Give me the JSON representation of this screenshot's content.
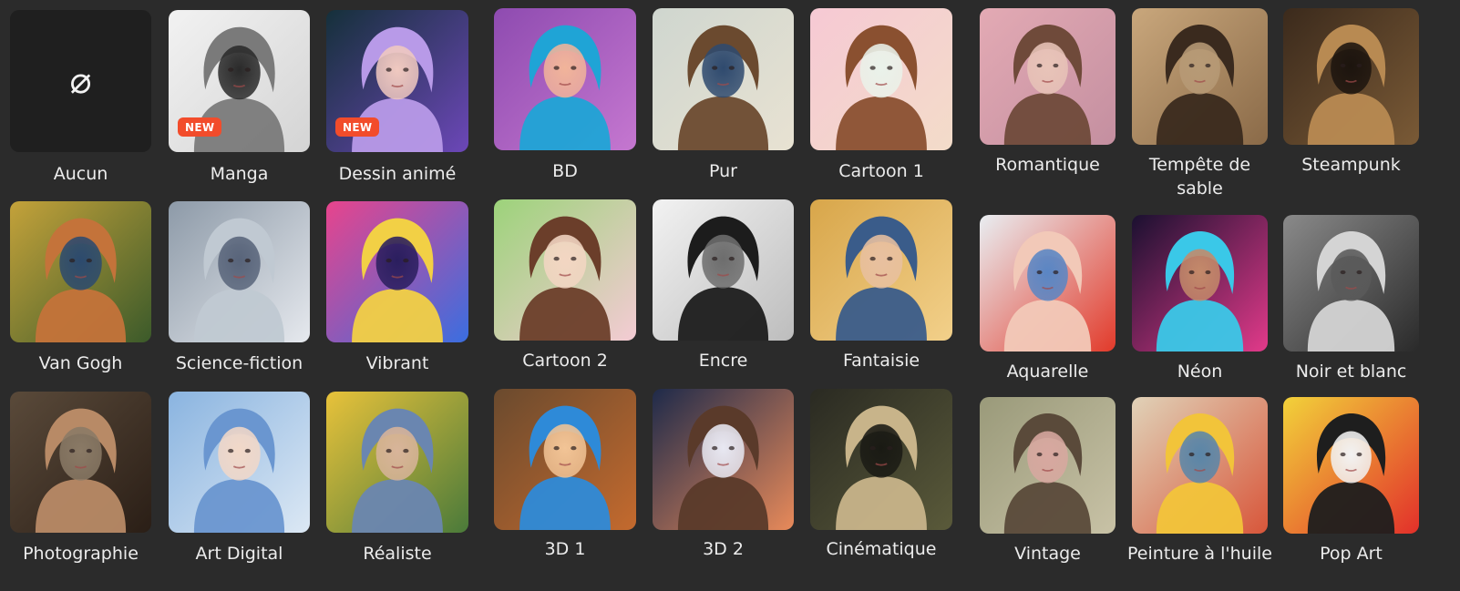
{
  "badge_label": "NEW",
  "none_symbol": "⌀",
  "styles": [
    {
      "label": "Aucun",
      "icon": "none-icon",
      "colors": [
        "#1f1f1f",
        "#1f1f1f",
        "#1f1f1f",
        "#1f1f1f"
      ]
    },
    {
      "label": "Manga",
      "icon": "manga-portrait-thumbnail",
      "colors": [
        "#f2f2f2",
        "#d4d4d4",
        "#7a7a7a",
        "#2a2a2a"
      ]
    },
    {
      "label": "Dessin animé",
      "icon": "cartoon-drawing-thumbnail",
      "colors": [
        "#15303a",
        "#6c47b8",
        "#b89ae8",
        "#f0c9c0"
      ]
    },
    {
      "label": "BD",
      "icon": "comic-thumbnail",
      "colors": [
        "#8e4bb0",
        "#c577d0",
        "#1fa4d6",
        "#f1b49a"
      ]
    },
    {
      "label": "Pur",
      "icon": "pure-photo-thumbnail",
      "colors": [
        "#cfd6cf",
        "#e8e2d2",
        "#6b4a2f",
        "#2f4a6e"
      ]
    },
    {
      "label": "Cartoon 1",
      "icon": "cartoon1-thumbnail",
      "colors": [
        "#f6c9d4",
        "#f3dcc9",
        "#8a5030",
        "#eaf2ea"
      ]
    },
    {
      "label": "Romantique",
      "icon": "romantic-thumbnail",
      "colors": [
        "#e3aab4",
        "#c48fa0",
        "#6f4a3a",
        "#e8c4b8"
      ]
    },
    {
      "label": "Tempête de sable",
      "icon": "sandstorm-thumbnail",
      "colors": [
        "#c9a77c",
        "#8a6a48",
        "#3a2a1e",
        "#b79a76"
      ]
    },
    {
      "label": "Steampunk",
      "icon": "steampunk-thumbnail",
      "colors": [
        "#3b2a1c",
        "#7a5a36",
        "#b88a52",
        "#1c140e"
      ]
    },
    {
      "label": "Van Gogh",
      "icon": "van-gogh-thumbnail",
      "colors": [
        "#c4a23a",
        "#3b5a2a",
        "#c4733a",
        "#2c4a6e"
      ]
    },
    {
      "label": "Science-fiction",
      "icon": "scifi-thumbnail",
      "colors": [
        "#8d9aa8",
        "#e6e9ee",
        "#c0c9d2",
        "#58647a"
      ]
    },
    {
      "label": "Vibrant",
      "icon": "vibrant-thumbnail",
      "colors": [
        "#e8448c",
        "#3a6ee0",
        "#f2d045",
        "#2a1e5e"
      ]
    },
    {
      "label": "Cartoon 2",
      "icon": "cartoon2-thumbnail",
      "colors": [
        "#9cd37a",
        "#f4cbd4",
        "#6b3e2a",
        "#f3d6c3"
      ]
    },
    {
      "label": "Encre",
      "icon": "ink-thumbnail",
      "colors": [
        "#f2f2f2",
        "#bdbdbd",
        "#1c1c1c",
        "#6d6d6d"
      ]
    },
    {
      "label": "Fantaisie",
      "icon": "fantasy-thumbnail",
      "colors": [
        "#d8a64a",
        "#f2d08a",
        "#3a5c8a",
        "#e8c0a0"
      ]
    },
    {
      "label": "Aquarelle",
      "icon": "watercolor-thumbnail",
      "colors": [
        "#e9eef2",
        "#e23a2a",
        "#f2c9b8",
        "#5a86c4"
      ]
    },
    {
      "label": "Néon",
      "icon": "neon-thumbnail",
      "colors": [
        "#1a1030",
        "#e23a8a",
        "#3ac8e8",
        "#c48a6a"
      ]
    },
    {
      "label": "Noir et blanc",
      "icon": "black-white-thumbnail",
      "colors": [
        "#8a8a8a",
        "#2a2a2a",
        "#d4d4d4",
        "#5a5a5a"
      ]
    },
    {
      "label": "Photographie",
      "icon": "photography-thumbnail",
      "colors": [
        "#5a4a3a",
        "#2a1e16",
        "#b88a66",
        "#8a7a66"
      ]
    },
    {
      "label": "Art Digital",
      "icon": "digital-art-thumbnail",
      "colors": [
        "#8ab4e0",
        "#dce8f4",
        "#6a96d0",
        "#f2d8c8"
      ]
    },
    {
      "label": "Réaliste",
      "icon": "realistic-thumbnail",
      "colors": [
        "#e8c23a",
        "#4a7a3a",
        "#6a86b0",
        "#d8b49a"
      ]
    },
    {
      "label": "3D 1",
      "icon": "3d1-thumbnail",
      "colors": [
        "#6a4a2e",
        "#c46a2e",
        "#2e8ad8",
        "#f2c496"
      ]
    },
    {
      "label": "3D 2",
      "icon": "3d2-thumbnail",
      "colors": [
        "#1e2a4a",
        "#e88a5a",
        "#5a3a2a",
        "#e8e8f2"
      ]
    },
    {
      "label": "Cinématique",
      "icon": "cinematic-thumbnail",
      "colors": [
        "#2a2a22",
        "#5a5a3a",
        "#c8b48a",
        "#1a1a14"
      ]
    },
    {
      "label": "Vintage",
      "icon": "vintage-thumbnail",
      "colors": [
        "#9a9a7a",
        "#c8c2a6",
        "#5a4a3a",
        "#d8a8a0"
      ]
    },
    {
      "label": "Peinture à l'huile",
      "icon": "oil-painting-thumbnail",
      "colors": [
        "#e0d2b8",
        "#d8563a",
        "#f2c43a",
        "#5a86a8"
      ]
    },
    {
      "label": "Pop Art",
      "icon": "pop-art-thumbnail",
      "colors": [
        "#f2d23a",
        "#e2302a",
        "#1e1e1e",
        "#f2f2f2"
      ]
    }
  ]
}
